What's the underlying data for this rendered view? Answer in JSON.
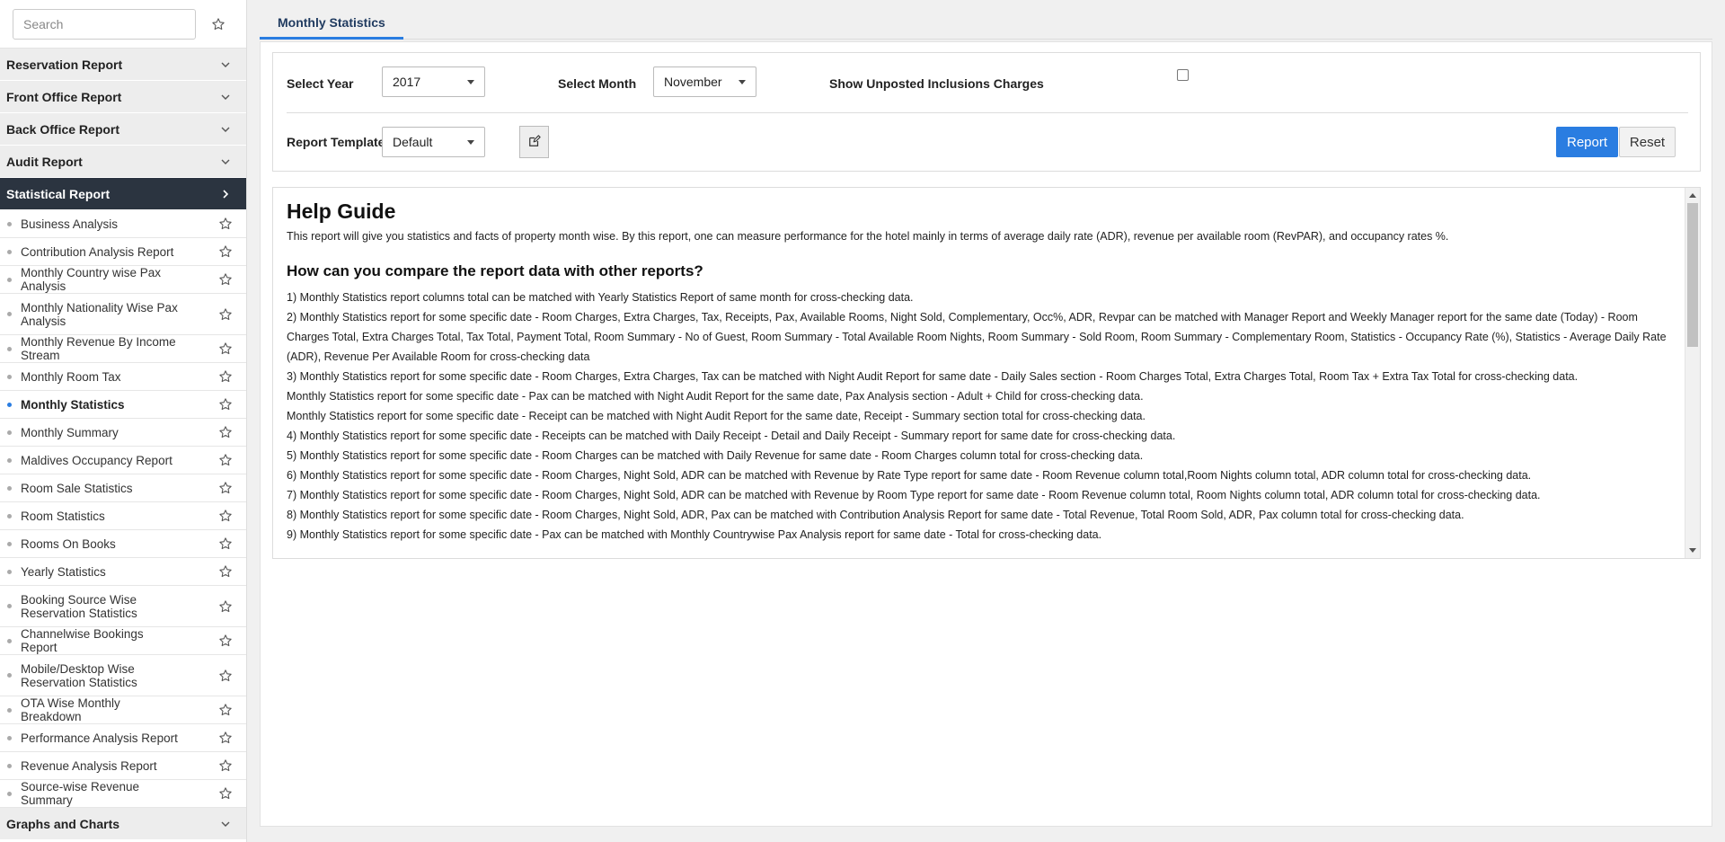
{
  "sidebar": {
    "search_placeholder": "Search",
    "categories_top": [
      {
        "label": "Reservation Report"
      },
      {
        "label": "Front Office Report"
      },
      {
        "label": "Back Office Report"
      },
      {
        "label": "Audit Report"
      }
    ],
    "active_category": {
      "label": "Statistical Report"
    },
    "items": [
      {
        "label": "Business Analysis"
      },
      {
        "label": "Contribution Analysis Report"
      },
      {
        "label": "Monthly Country wise Pax Analysis"
      },
      {
        "label": "Monthly Nationality Wise Pax Analysis"
      },
      {
        "label": "Monthly Revenue By Income Stream"
      },
      {
        "label": "Monthly Room Tax"
      },
      {
        "label": "Monthly Statistics"
      },
      {
        "label": "Monthly Summary"
      },
      {
        "label": "Maldives Occupancy Report"
      },
      {
        "label": "Room Sale Statistics"
      },
      {
        "label": "Room Statistics"
      },
      {
        "label": "Rooms On Books"
      },
      {
        "label": "Yearly Statistics"
      },
      {
        "label": "Booking Source Wise Reservation Statistics"
      },
      {
        "label": "Channelwise Bookings Report"
      },
      {
        "label": "Mobile/Desktop Wise Reservation Statistics"
      },
      {
        "label": "OTA Wise Monthly Breakdown"
      },
      {
        "label": "Performance Analysis Report"
      },
      {
        "label": "Revenue Analysis Report"
      },
      {
        "label": "Source-wise Revenue Summary"
      }
    ],
    "categories_bottom": [
      {
        "label": "Graphs and Charts"
      }
    ]
  },
  "tab": {
    "label": "Monthly Statistics"
  },
  "filters": {
    "year_label": "Select Year",
    "year_value": "2017",
    "month_label": "Select Month",
    "month_value": "November",
    "unposted_label": "Show Unposted Inclusions Charges",
    "unposted_checked": false,
    "template_label": "Report Template",
    "template_value": "Default",
    "report_button": "Report",
    "reset_button": "Reset"
  },
  "help": {
    "title": "Help Guide",
    "intro": "This report will give you statistics and facts of property month wise. By this report, one can measure performance for the hotel mainly in terms of average daily rate (ADR), revenue per available room (RevPAR), and occupancy rates %.",
    "compare_heading": "How can you compare the report data with other reports?",
    "lines": [
      "1) Monthly Statistics report columns total can be matched with Yearly Statistics Report of same month for cross-checking data.",
      "2) Monthly Statistics report for some specific date - Room Charges, Extra Charges, Tax, Receipts, Pax, Available Rooms, Night Sold, Complementary, Occ%, ADR, Revpar can be matched with Manager Report and Weekly Manager report for the same date (Today) - Room Charges Total, Extra Charges Total, Tax Total, Payment Total, Room Summary - No of Guest, Room Summary - Total Available Room Nights, Room Summary - Sold Room, Room Summary - Complementary Room, Statistics - Occupancy Rate (%), Statistics - Average Daily Rate (ADR), Revenue Per Available Room for cross-checking data",
      "3) Monthly Statistics report for some specific date - Room Charges, Extra Charges, Tax can be matched with Night Audit Report for same date - Daily Sales section - Room Charges Total, Extra Charges Total, Room Tax + Extra Tax Total for cross-checking data.",
      "Monthly Statistics report for some specific date - Pax can be matched with Night Audit Report for the same date, Pax Analysis section - Adult + Child for cross-checking data.",
      "Monthly Statistics report for some specific date - Receipt can be matched with Night Audit Report for the same date, Receipt - Summary section total for cross-checking data.",
      "4) Monthly Statistics report for some specific date - Receipts can be matched with Daily Receipt - Detail and Daily Receipt - Summary report for same date for cross-checking data.",
      "5) Monthly Statistics report for some specific date - Room Charges can be matched with Daily Revenue for same date - Room Charges column total for cross-checking data.",
      "6) Monthly Statistics report for some specific date - Room Charges, Night Sold, ADR can be matched with Revenue by Rate Type report for same date - Room Revenue column total,Room Nights column total, ADR column total for cross-checking data.",
      "7) Monthly Statistics report for some specific date - Room Charges, Night Sold, ADR can be matched with Revenue by Room Type report for same date - Room Revenue column total, Room Nights column total, ADR column total for cross-checking data.",
      "8) Monthly Statistics report for some specific date - Room Charges, Night Sold, ADR, Pax can be matched with Contribution Analysis Report for same date - Total Revenue, Total Room Sold, ADR, Pax column total for cross-checking data.",
      "9) Monthly Statistics report for some specific date - Pax can be matched with Monthly Countrywise Pax Analysis report for same date - Total for cross-checking data."
    ]
  },
  "colors": {
    "accent": "#2a7de1",
    "active_category_bg": "#2b3440",
    "category_bg": "#ededed"
  },
  "icons": {
    "favorite": "star-outline-icon",
    "expand": "chevron-down-icon",
    "collapse_active": "chevron-right-icon",
    "edit": "edit-icon",
    "dropdown": "caret-down-icon"
  }
}
